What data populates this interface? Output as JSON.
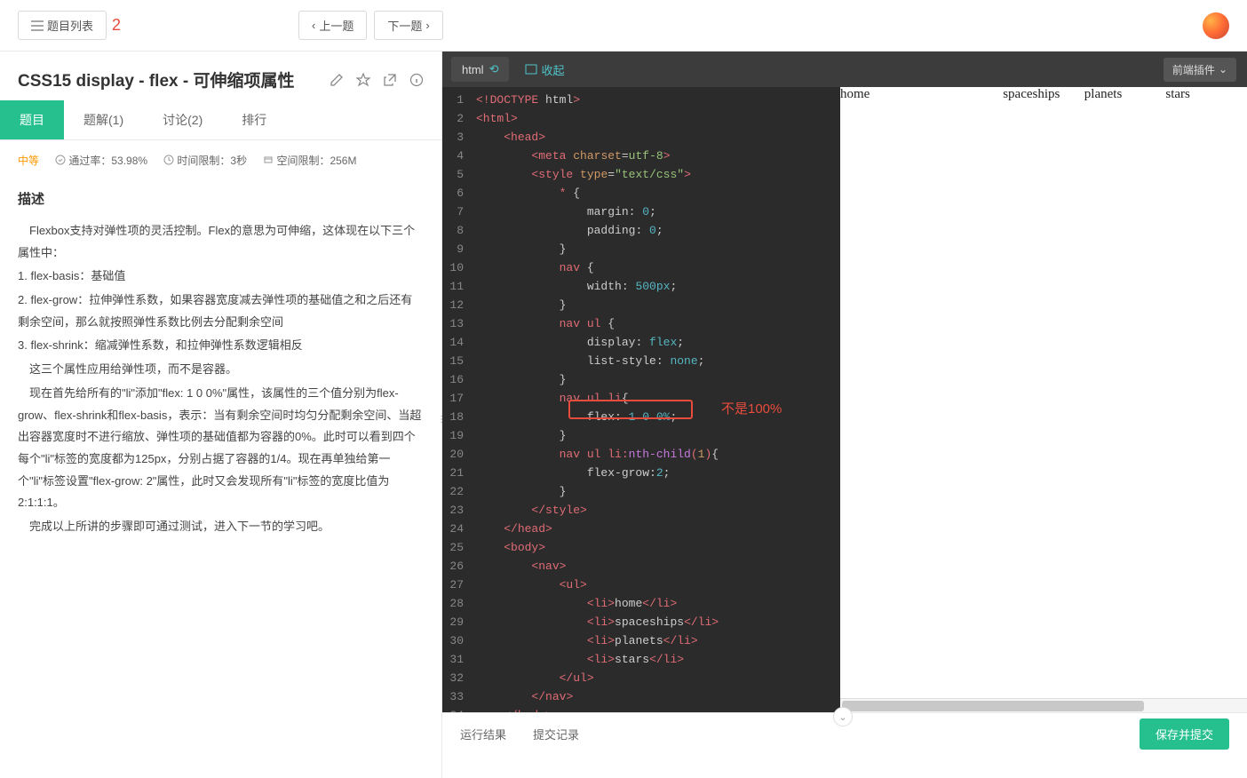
{
  "header": {
    "list_btn": "题目列表",
    "notif_count": "2",
    "prev_btn": "上一题",
    "next_btn": "下一题"
  },
  "problem": {
    "title": "CSS15  display - flex - 可伸缩项属性",
    "tabs": {
      "question": "题目",
      "solution": "题解(1)",
      "discuss": "讨论(2)",
      "rank": "排行"
    },
    "meta": {
      "level": "中等",
      "pass_rate": "通过率：53.98%",
      "time_limit": "时间限制：3秒",
      "space_limit": "空间限制：256M"
    },
    "desc_title": "描述",
    "desc_body": "　Flexbox支持对弹性项的灵活控制。Flex的意思为可伸缩，这体现在以下三个属性中：\n1. flex-basis：基础值\n2. flex-grow：拉伸弹性系数，如果容器宽度减去弹性项的基础值之和之后还有剩余空间，那么就按照弹性系数比例去分配剩余空间\n3. flex-shrink：缩减弹性系数，和拉伸弹性系数逻辑相反\n　这三个属性应用给弹性项，而不是容器。\n　现在首先给所有的\"li\"添加\"flex: 1 0 0%\"属性，该属性的三个值分别为flex-grow、flex-shrink和flex-basis，表示：当有剩余空间时均匀分配剩余空间、当超出容器宽度时不进行缩放、弹性项的基础值都为容器的0%。此时可以看到四个每个\"li\"标签的宽度都为125px，分别占据了容器的1/4。现在再单独给第一个\"li\"标签设置\"flex-grow: 2\"属性，此时又会发现所有\"li\"标签的宽度比值为2:1:1:1。\n　完成以上所讲的步骤即可通过测试，进入下一节的学习吧。"
  },
  "editor": {
    "lang": "html",
    "collapse": "收起",
    "plugin": "前端插件",
    "annotation": "不是100%",
    "lines": [
      "<!DOCTYPE html>",
      "<html>",
      "    <head>",
      "        <meta charset=utf-8>",
      "        <style type=\"text/css\">",
      "            * {",
      "                margin: 0;",
      "                padding: 0;",
      "            }",
      "            nav {",
      "                width: 500px;",
      "            }",
      "            nav ul {",
      "                display: flex;",
      "                list-style: none;",
      "            }",
      "            nav ul li{",
      "                flex: 1 0 0%;",
      "            }",
      "            nav ul li:nth-child(1){",
      "                flex-grow:2;",
      "            }",
      "        </style>",
      "    </head>",
      "    <body>",
      "        <nav>",
      "            <ul>",
      "                <li>home</li>",
      "                <li>spaceships</li>",
      "                <li>planets</li>",
      "                <li>stars</li>",
      "            </ul>",
      "        </nav>",
      "    </body>"
    ]
  },
  "preview": {
    "items": [
      "home",
      "spaceships",
      "planets",
      "stars"
    ]
  },
  "bottom": {
    "run_result": "运行结果",
    "submit_history": "提交记录",
    "submit_btn": "保存并提交"
  }
}
